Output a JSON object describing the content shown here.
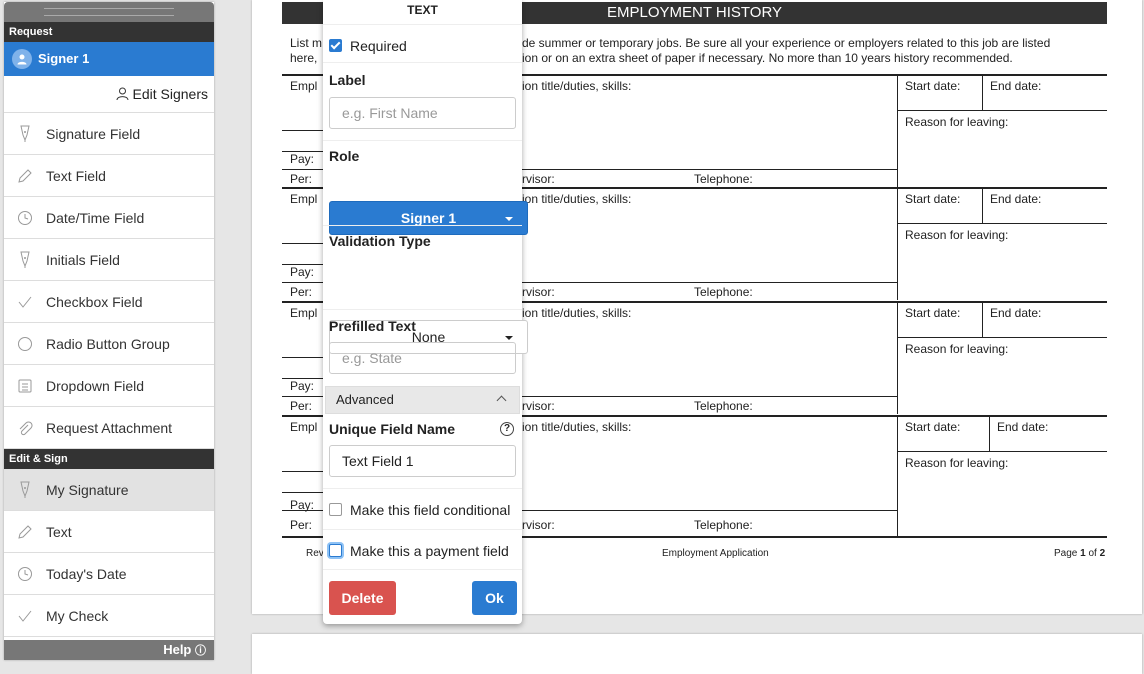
{
  "sidebar": {
    "request_section": "Request",
    "signer": "Signer 1",
    "edit_signers": "Edit Signers",
    "request_items": [
      {
        "label": "Signature Field",
        "icon": "pen-nib-icon"
      },
      {
        "label": "Text Field",
        "icon": "pencil-icon"
      },
      {
        "label": "Date/Time Field",
        "icon": "clock-icon"
      },
      {
        "label": "Initials Field",
        "icon": "pen-nib-icon"
      },
      {
        "label": "Checkbox Field",
        "icon": "checkmark-icon"
      },
      {
        "label": "Radio Button Group",
        "icon": "circle-icon"
      },
      {
        "label": "Dropdown Field",
        "icon": "list-icon"
      },
      {
        "label": "Request Attachment",
        "icon": "paperclip-icon"
      }
    ],
    "edit_section": "Edit & Sign",
    "edit_items": [
      {
        "label": "My Signature",
        "icon": "pen-nib-icon"
      },
      {
        "label": "Text",
        "icon": "pencil-icon"
      },
      {
        "label": "Today's Date",
        "icon": "clock-icon"
      },
      {
        "label": "My Check",
        "icon": "checkmark-icon"
      }
    ],
    "help": "Help"
  },
  "document": {
    "title": "EMPLOYMENT HISTORY",
    "intro_line1_a": "List m",
    "intro_line1_b": "de summer or temporary jobs. Be sure all your experience or employers related to this job are listed",
    "intro_line2_a": "here,",
    "intro_line2_b": "ion or on an extra sheet of paper if necessary. No more than 10 years history recommended.",
    "empl": "Empl",
    "position": "ion title/duties, skills:",
    "start": "Start date:",
    "end": "End date:",
    "reason": "Reason for leaving:",
    "pay": "Pay:",
    "per": "Per:",
    "supervisor": "rvisor:",
    "telephone": "Telephone:",
    "footer_left": "Rev",
    "footer_center": "Employment Application",
    "footer_page_prefix": "Page",
    "footer_page_num": "1",
    "footer_of": "of",
    "footer_total": "2"
  },
  "popup": {
    "title": "TEXT",
    "required": "Required",
    "label_heading": "Label",
    "label_placeholder": "e.g. First Name",
    "role_heading": "Role",
    "role_value": "Signer 1",
    "validation_heading": "Validation Type",
    "validation_value": "None",
    "prefilled_heading": "Prefilled Text",
    "prefilled_placeholder": "e.g. State",
    "advanced": "Advanced",
    "unique_heading": "Unique Field Name",
    "unique_value": "Text Field 1",
    "conditional": "Make this field conditional",
    "payment": "Make this a payment field",
    "delete": "Delete",
    "ok": "Ok"
  }
}
